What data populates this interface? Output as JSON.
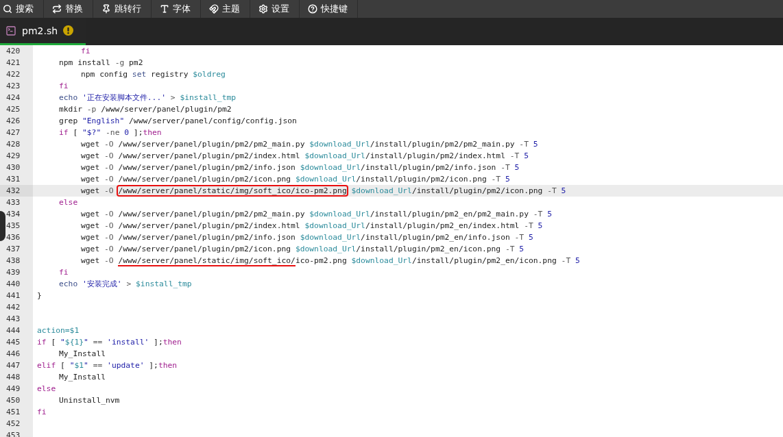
{
  "toolbar": [
    {
      "label": "搜索"
    },
    {
      "label": "替换"
    },
    {
      "label": "跳转行"
    },
    {
      "label": "字体"
    },
    {
      "label": "主题"
    },
    {
      "label": "设置"
    },
    {
      "label": "快捷键"
    }
  ],
  "tabs": [
    {
      "label": "pm2.sh",
      "selected": true,
      "warning": true
    }
  ],
  "lines": [
    {
      "num": "420",
      "current": false,
      "tokens": [
        {
          "kind": "kw",
          "text": "\t\tfi"
        }
      ]
    },
    {
      "num": "421",
      "current": false,
      "tokens": [
        {
          "kind": "pl",
          "text": "\tnpm install "
        },
        {
          "kind": "op",
          "text": "-g "
        },
        {
          "kind": "pl",
          "text": "pm2"
        }
      ]
    },
    {
      "num": "422",
      "current": false,
      "tokens": [
        {
          "kind": "pl",
          "text": "\t\tnpm config "
        },
        {
          "kind": "bi",
          "text": "set"
        },
        {
          "kind": "pl",
          "text": " registry "
        },
        {
          "kind": "var",
          "text": "$oldreg"
        }
      ]
    },
    {
      "num": "423",
      "current": false,
      "tokens": [
        {
          "kind": "kw",
          "text": "\tfi"
        }
      ]
    },
    {
      "num": "424",
      "current": false,
      "tokens": [
        {
          "kind": "bi",
          "text": "\techo "
        },
        {
          "kind": "str",
          "text": "'正在安装脚本文件...'"
        },
        {
          "kind": "op",
          "text": " > "
        },
        {
          "kind": "var",
          "text": "$install_tmp"
        }
      ]
    },
    {
      "num": "425",
      "current": false,
      "tokens": [
        {
          "kind": "pl",
          "text": "\tmkdir "
        },
        {
          "kind": "op",
          "text": "-p "
        },
        {
          "kind": "pl",
          "text": "/www/server/panel/plugin/pm2"
        }
      ]
    },
    {
      "num": "426",
      "current": false,
      "tokens": [
        {
          "kind": "pl",
          "text": "\tgrep "
        },
        {
          "kind": "str",
          "text": "\"English\""
        },
        {
          "kind": "pl",
          "text": " /www/server/panel/config/config.json"
        }
      ]
    },
    {
      "num": "427",
      "current": false,
      "tokens": [
        {
          "kind": "kw",
          "text": "\tif"
        },
        {
          "kind": "pl",
          "text": " [ "
        },
        {
          "kind": "str",
          "text": "\"$?\""
        },
        {
          "kind": "op",
          "text": " -ne "
        },
        {
          "kind": "num",
          "text": "0"
        },
        {
          "kind": "pl",
          "text": " ];"
        },
        {
          "kind": "kw",
          "text": "then"
        }
      ]
    },
    {
      "num": "428",
      "current": false,
      "tokens": [
        {
          "kind": "pl",
          "text": "\t\twget "
        },
        {
          "kind": "op",
          "text": "-O "
        },
        {
          "kind": "pl",
          "text": "/www/server/panel/plugin/pm2/pm2_main.py "
        },
        {
          "kind": "var",
          "text": "$download_Url"
        },
        {
          "kind": "pl",
          "text": "/install/plugin/pm2/pm2_main.py "
        },
        {
          "kind": "op",
          "text": "-T "
        },
        {
          "kind": "num",
          "text": "5"
        }
      ]
    },
    {
      "num": "429",
      "current": false,
      "tokens": [
        {
          "kind": "pl",
          "text": "\t\twget "
        },
        {
          "kind": "op",
          "text": "-O "
        },
        {
          "kind": "pl",
          "text": "/www/server/panel/plugin/pm2/index.html "
        },
        {
          "kind": "var",
          "text": "$download_Url"
        },
        {
          "kind": "pl",
          "text": "/install/plugin/pm2/index.html "
        },
        {
          "kind": "op",
          "text": "-T "
        },
        {
          "kind": "num",
          "text": "5"
        }
      ]
    },
    {
      "num": "430",
      "current": false,
      "tokens": [
        {
          "kind": "pl",
          "text": "\t\twget "
        },
        {
          "kind": "op",
          "text": "-O "
        },
        {
          "kind": "pl",
          "text": "/www/server/panel/plugin/pm2/info.json "
        },
        {
          "kind": "var",
          "text": "$download_Url"
        },
        {
          "kind": "pl",
          "text": "/install/plugin/pm2/info.json "
        },
        {
          "kind": "op",
          "text": "-T "
        },
        {
          "kind": "num",
          "text": "5"
        }
      ]
    },
    {
      "num": "431",
      "current": false,
      "tokens": [
        {
          "kind": "pl",
          "text": "\t\twget "
        },
        {
          "kind": "op",
          "text": "-O "
        },
        {
          "kind": "pl",
          "text": "/www/server/panel/plugin/pm2/icon.png "
        },
        {
          "kind": "var",
          "text": "$download_Url"
        },
        {
          "kind": "pl",
          "text": "/install/plugin/pm2/icon.png "
        },
        {
          "kind": "op",
          "text": "-T "
        },
        {
          "kind": "num",
          "text": "5"
        }
      ]
    },
    {
      "num": "432",
      "current": true,
      "tokens": [
        {
          "kind": "pl",
          "text": "\t\twget "
        },
        {
          "kind": "op",
          "text": "-O "
        },
        {
          "kind": "pl",
          "text": "/www/server/panel/static/img/soft_ico/ico-pm2.png",
          "boxed": true
        },
        {
          "kind": "var",
          "text": " $download_Url"
        },
        {
          "kind": "pl",
          "text": "/install/plugin/pm2/icon.png "
        },
        {
          "kind": "op",
          "text": "-T "
        },
        {
          "kind": "num",
          "text": "5"
        }
      ]
    },
    {
      "num": "433",
      "current": false,
      "tokens": [
        {
          "kind": "kw",
          "text": "\telse"
        }
      ]
    },
    {
      "num": "434",
      "current": false,
      "tokens": [
        {
          "kind": "pl",
          "text": "\t\twget "
        },
        {
          "kind": "op",
          "text": "-O "
        },
        {
          "kind": "pl",
          "text": "/www/server/panel/plugin/pm2/pm2_main.py "
        },
        {
          "kind": "var",
          "text": "$download_Url"
        },
        {
          "kind": "pl",
          "text": "/install/plugin/pm2_en/pm2_main.py "
        },
        {
          "kind": "op",
          "text": "-T "
        },
        {
          "kind": "num",
          "text": "5"
        }
      ]
    },
    {
      "num": "435",
      "current": false,
      "tokens": [
        {
          "kind": "pl",
          "text": "\t\twget "
        },
        {
          "kind": "op",
          "text": "-O "
        },
        {
          "kind": "pl",
          "text": "/www/server/panel/plugin/pm2/index.html "
        },
        {
          "kind": "var",
          "text": "$download_Url"
        },
        {
          "kind": "pl",
          "text": "/install/plugin/pm2_en/index.html "
        },
        {
          "kind": "op",
          "text": "-T "
        },
        {
          "kind": "num",
          "text": "5"
        }
      ]
    },
    {
      "num": "436",
      "current": false,
      "tokens": [
        {
          "kind": "pl",
          "text": "\t\twget "
        },
        {
          "kind": "op",
          "text": "-O "
        },
        {
          "kind": "pl",
          "text": "/www/server/panel/plugin/pm2/info.json "
        },
        {
          "kind": "var",
          "text": "$download_Url"
        },
        {
          "kind": "pl",
          "text": "/install/plugin/pm2_en/info.json "
        },
        {
          "kind": "op",
          "text": "-T "
        },
        {
          "kind": "num",
          "text": "5"
        }
      ]
    },
    {
      "num": "437",
      "current": false,
      "tokens": [
        {
          "kind": "pl",
          "text": "\t\twget "
        },
        {
          "kind": "op",
          "text": "-O "
        },
        {
          "kind": "pl",
          "text": "/www/server/panel/plugin/pm2/icon.png "
        },
        {
          "kind": "var",
          "text": "$download_Url"
        },
        {
          "kind": "pl",
          "text": "/install/plugin/pm2_en/icon.png "
        },
        {
          "kind": "op",
          "text": "-T "
        },
        {
          "kind": "num",
          "text": "5"
        }
      ]
    },
    {
      "num": "438",
      "current": false,
      "tokens": [
        {
          "kind": "pl",
          "text": "\t\twget "
        },
        {
          "kind": "op",
          "text": "-O "
        },
        {
          "kind": "pl",
          "text": "/www/server/panel/static/img/soft_ico/",
          "underlined": true
        },
        {
          "kind": "pl",
          "text": "ico-pm2.png "
        },
        {
          "kind": "var",
          "text": "$download_Url"
        },
        {
          "kind": "pl",
          "text": "/install/plugin/pm2_en/icon.png "
        },
        {
          "kind": "op",
          "text": "-T "
        },
        {
          "kind": "num",
          "text": "5"
        }
      ]
    },
    {
      "num": "439",
      "current": false,
      "tokens": [
        {
          "kind": "kw",
          "text": "\tfi"
        }
      ]
    },
    {
      "num": "440",
      "current": false,
      "tokens": [
        {
          "kind": "bi",
          "text": "\techo "
        },
        {
          "kind": "str",
          "text": "'安装完成'"
        },
        {
          "kind": "op",
          "text": " > "
        },
        {
          "kind": "var",
          "text": "$install_tmp"
        }
      ]
    },
    {
      "num": "441",
      "current": false,
      "tokens": [
        {
          "kind": "pl",
          "text": "}"
        }
      ]
    },
    {
      "num": "442",
      "current": false
    },
    {
      "num": "443",
      "current": false
    },
    {
      "num": "444",
      "current": false,
      "tokens": [
        {
          "kind": "var",
          "text": "action=$1"
        }
      ]
    },
    {
      "num": "445",
      "current": false,
      "tokens": [
        {
          "kind": "kw",
          "text": "if"
        },
        {
          "kind": "pl",
          "text": " [ "
        },
        {
          "kind": "str",
          "text": "\""
        },
        {
          "kind": "var",
          "text": "${1}"
        },
        {
          "kind": "str",
          "text": "\""
        },
        {
          "kind": "op",
          "text": " == "
        },
        {
          "kind": "str",
          "text": "'install'"
        },
        {
          "kind": "pl",
          "text": " ];"
        },
        {
          "kind": "kw",
          "text": "then"
        }
      ]
    },
    {
      "num": "446",
      "current": false,
      "tokens": [
        {
          "kind": "pl",
          "text": "\tMy_Install"
        }
      ]
    },
    {
      "num": "447",
      "current": false,
      "tokens": [
        {
          "kind": "kw",
          "text": "elif"
        },
        {
          "kind": "pl",
          "text": " [ "
        },
        {
          "kind": "str",
          "text": "\""
        },
        {
          "kind": "var",
          "text": "$1"
        },
        {
          "kind": "str",
          "text": "\""
        },
        {
          "kind": "op",
          "text": " == "
        },
        {
          "kind": "str",
          "text": "'update'"
        },
        {
          "kind": "pl",
          "text": " ];"
        },
        {
          "kind": "kw",
          "text": "then"
        }
      ]
    },
    {
      "num": "448",
      "current": false,
      "tokens": [
        {
          "kind": "pl",
          "text": "\tMy_Install"
        }
      ]
    },
    {
      "num": "449",
      "current": false,
      "tokens": [
        {
          "kind": "kw",
          "text": "else"
        }
      ]
    },
    {
      "num": "450",
      "current": false,
      "tokens": [
        {
          "kind": "pl",
          "text": "\tUninstall_nvm"
        }
      ]
    },
    {
      "num": "451",
      "current": false,
      "tokens": [
        {
          "kind": "kw",
          "text": "fi"
        }
      ]
    },
    {
      "num": "452",
      "current": false
    },
    {
      "num": "453",
      "current": false
    }
  ]
}
